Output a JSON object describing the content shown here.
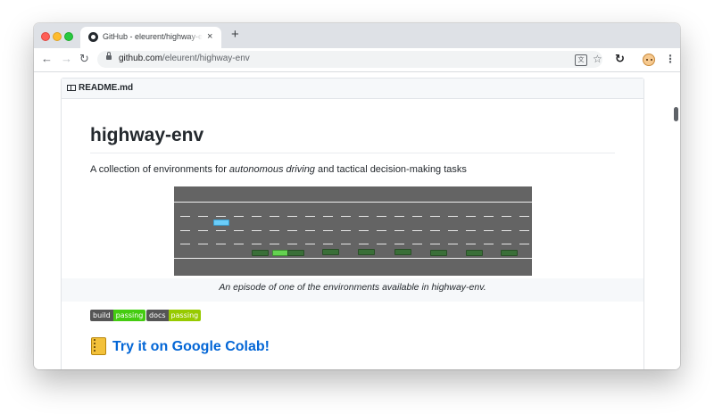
{
  "browser": {
    "tab": {
      "title": "GitHub - eleurent/highway-env",
      "close": "×"
    },
    "new_tab": "+",
    "nav": {
      "back": "←",
      "forward": "→",
      "reload": "↻"
    },
    "url": {
      "host": "github.com",
      "path": "/eleurent/highway-env"
    },
    "icons": {
      "translate": "文",
      "star": "☆",
      "sync": "↻",
      "menu": "⋮"
    }
  },
  "readme": {
    "filename": "README.md",
    "heading": "highway-env",
    "description": {
      "before": "A collection of environments for ",
      "emphasis": "autonomous driving",
      "after": " and tactical decision-making tasks"
    },
    "caption": "An episode of one of the environments available in highway-env.",
    "badges": [
      {
        "label": "build",
        "status": "passing",
        "color": "#44cc11"
      },
      {
        "label": "docs",
        "status": "passing",
        "color": "#97ca00"
      }
    ],
    "colab_link": "Try it on Google Colab!"
  },
  "colors": {
    "link": "#0366d6",
    "road": "#646464",
    "ego_vehicle": "#6bcdf9",
    "controlled_vehicle": "#64d250",
    "other_vehicle": "#3a6f38"
  }
}
